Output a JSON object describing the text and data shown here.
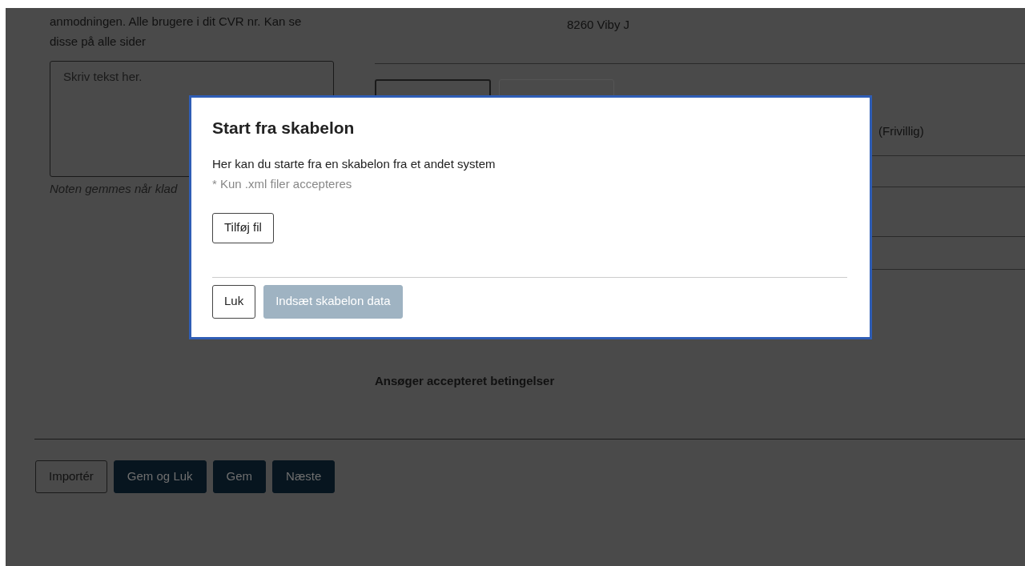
{
  "page": {
    "notes_text": "anmodningen. Alle brugere i dit CVR nr. Kan se disse på alle sider",
    "notes_placeholder": "Skriv tekst her.",
    "notes_hint": "Noten gemmes når klad",
    "address": "8260 Viby J",
    "optional_label": "(Frivillig)",
    "terms_label": "Ansøger accepteret betingelser",
    "actions": [
      {
        "label": "Importér",
        "kind": "outline"
      },
      {
        "label": "Gem og Luk",
        "kind": "primary"
      },
      {
        "label": "Gem",
        "kind": "primary"
      },
      {
        "label": "Næste",
        "kind": "primary"
      }
    ]
  },
  "modal": {
    "title": "Start fra skabelon",
    "description": "Her kan du starte fra en skabelon fra et andet system",
    "hint": "* Kun .xml filer accepteres",
    "add_file_button": "Tilføj fil",
    "buttons": [
      {
        "label": "Luk",
        "kind": "outline",
        "disabled": false
      },
      {
        "label": "Indsæt skabelon data",
        "kind": "primary",
        "disabled": true
      }
    ]
  }
}
